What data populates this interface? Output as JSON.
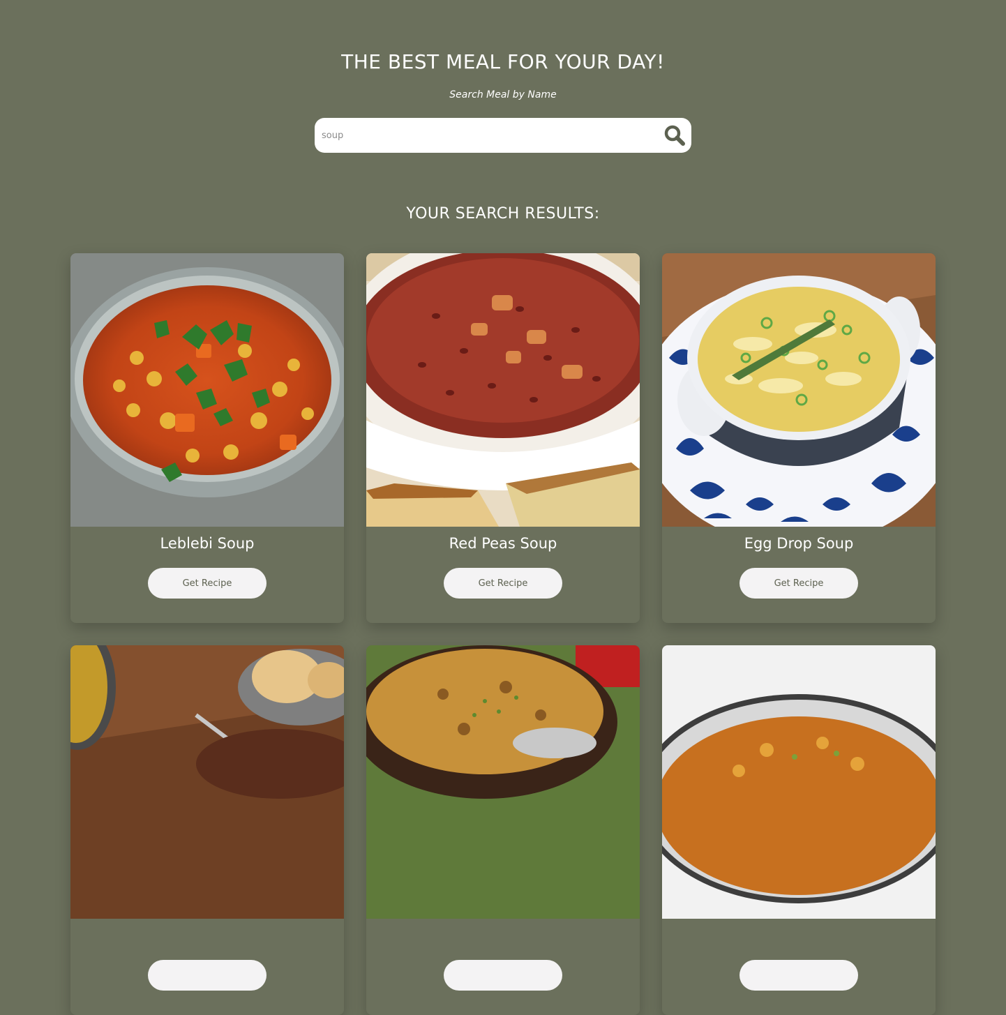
{
  "header": {
    "title": "THE BEST MEAL FOR YOUR DAY!",
    "subtitle": "Search Meal by Name"
  },
  "search": {
    "value": "soup",
    "icon": "search-icon"
  },
  "results": {
    "title": "YOUR SEARCH RESULTS:"
  },
  "meals": [
    {
      "name": "Leblebi Soup",
      "button_label": "Get Recipe"
    },
    {
      "name": "Red Peas Soup",
      "button_label": "Get Recipe"
    },
    {
      "name": "Egg Drop Soup",
      "button_label": "Get Recipe"
    },
    {
      "name": "",
      "button_label": ""
    },
    {
      "name": "",
      "button_label": ""
    },
    {
      "name": "",
      "button_label": ""
    }
  ],
  "colors": {
    "background": "#6b705c",
    "search_icon": "#5c6150",
    "button_bg": "#f4f3f4",
    "button_text": "#5d6150"
  }
}
